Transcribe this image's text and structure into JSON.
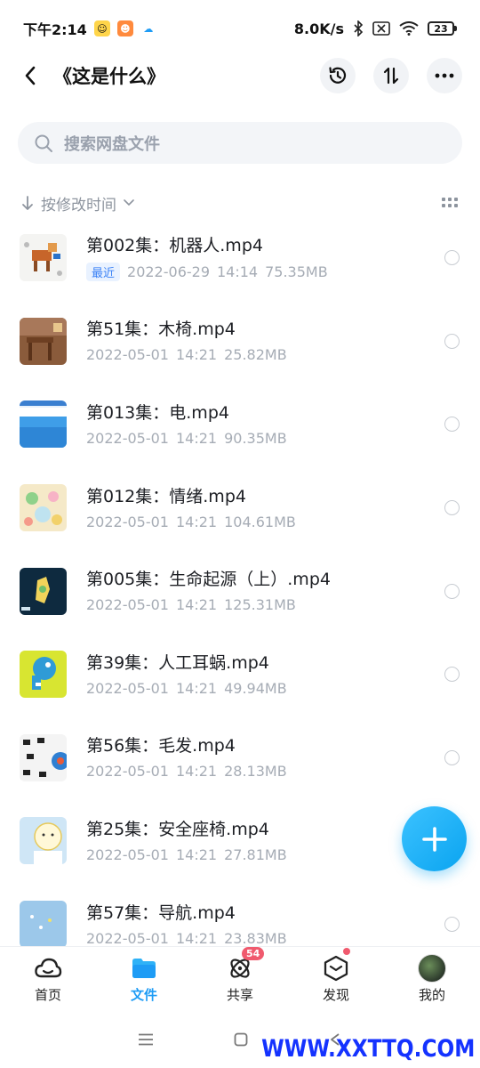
{
  "status_bar": {
    "time": "下午2:14",
    "network_speed": "8.0K/s",
    "battery": "23"
  },
  "header": {
    "title": "《这是什么》"
  },
  "search": {
    "placeholder": "搜索网盘文件"
  },
  "sort": {
    "label": "按修改时间"
  },
  "files": [
    {
      "name": "第002集：机器人.mp4",
      "badge": "最近",
      "date": "2022-06-29",
      "time": "14:14",
      "size": "75.35MB"
    },
    {
      "name": "第51集：木椅.mp4",
      "date": "2022-05-01",
      "time": "14:21",
      "size": "25.82MB"
    },
    {
      "name": "第013集：电.mp4",
      "date": "2022-05-01",
      "time": "14:21",
      "size": "90.35MB"
    },
    {
      "name": "第012集：情绪.mp4",
      "date": "2022-05-01",
      "time": "14:21",
      "size": "104.61MB"
    },
    {
      "name": "第005集：生命起源（上）.mp4",
      "date": "2022-05-01",
      "time": "14:21",
      "size": "125.31MB"
    },
    {
      "name": "第39集：人工耳蜗.mp4",
      "date": "2022-05-01",
      "time": "14:21",
      "size": "49.94MB"
    },
    {
      "name": "第56集：毛发.mp4",
      "date": "2022-05-01",
      "time": "14:21",
      "size": "28.13MB"
    },
    {
      "name": "第25集：安全座椅.mp4",
      "date": "2022-05-01",
      "time": "14:21",
      "size": "27.81MB"
    },
    {
      "name": "第57集：导航.mp4",
      "date": "2022-05-01",
      "time": "14:21",
      "size": "23.83MB"
    }
  ],
  "tabbar": {
    "tabs": [
      {
        "label": "首页"
      },
      {
        "label": "文件"
      },
      {
        "label": "共享",
        "badge": "54"
      },
      {
        "label": "发现"
      },
      {
        "label": "我的"
      }
    ]
  },
  "watermark": "WWW.XXTTQ.COM",
  "colors": {
    "accent": "#1e9cf5",
    "badge_red": "#f05a6e",
    "meta_gray": "#a6acb5"
  }
}
